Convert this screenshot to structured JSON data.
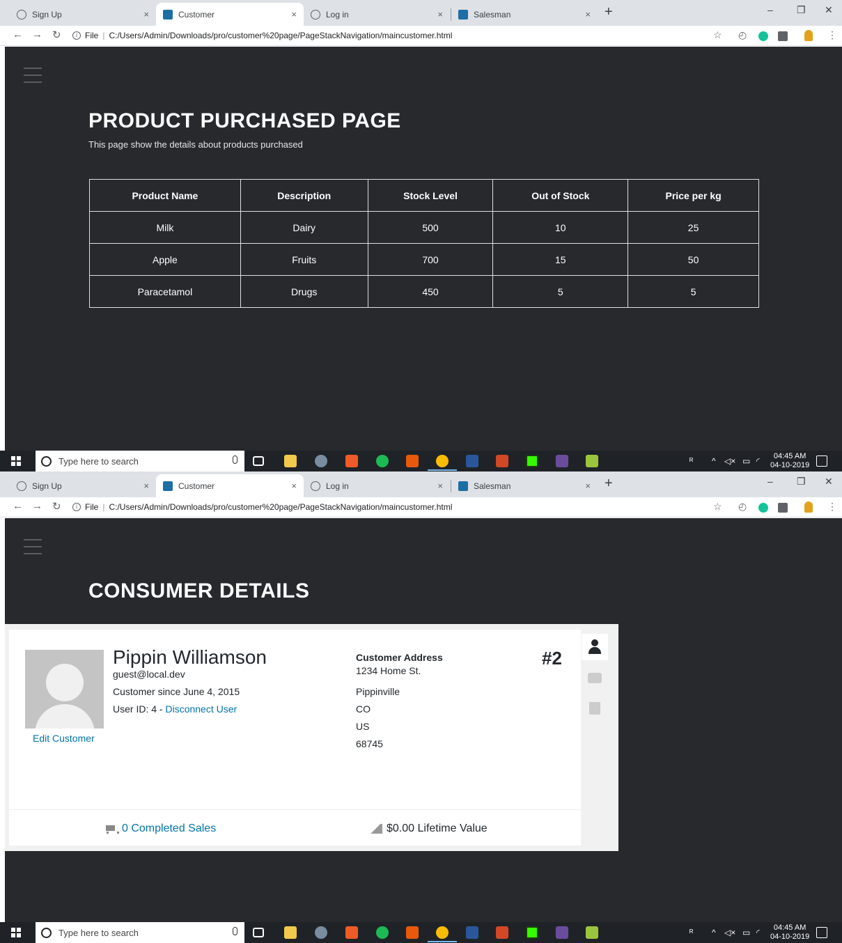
{
  "browser": {
    "tabs": [
      {
        "title": "Sign Up",
        "active": false
      },
      {
        "title": "Customer",
        "active": true
      },
      {
        "title": "Log in",
        "active": false
      },
      {
        "title": "Salesman",
        "active": false
      }
    ],
    "address_prefix": "File",
    "url": "C:/Users/Admin/Downloads/pro/customer%20page/PageStackNavigation/maincustomer.html",
    "new_tab_label": "+",
    "close_label": "×"
  },
  "products_page": {
    "title": "PRODUCT PURCHASED PAGE",
    "subtitle": "This page show the details about products purchased",
    "columns": [
      "Product Name",
      "Description",
      "Stock Level",
      "Out of Stock",
      "Price per kg"
    ],
    "rows": [
      [
        "Milk",
        "Dairy",
        "500",
        "10",
        "25"
      ],
      [
        "Apple",
        "Fruits",
        "700",
        "15",
        "50"
      ],
      [
        "Paracetamol",
        "Drugs",
        "450",
        "5",
        "5"
      ]
    ]
  },
  "consumer_page": {
    "title": "CONSUMER DETAILS",
    "customer": {
      "name": "Pippin Williamson",
      "email": "guest@local.dev",
      "since": "Customer since June 4, 2015",
      "user_id_label": "User ID:  4 - ",
      "disconnect_label": "Disconnect User",
      "edit_label": "Edit Customer",
      "number": "#2",
      "address_heading": "Customer Address",
      "address_lines": [
        "1234 Home St.",
        "Pippinville",
        "CO",
        "US",
        "68745"
      ],
      "sales_label": "0 Completed Sales",
      "lifetime_label": "$0.00 Lifetime Value"
    }
  },
  "taskbar": {
    "search_placeholder": "Type here to search",
    "time": "04:45 AM",
    "date": "04-10-2019"
  },
  "colors": {
    "page_bg": "#27292d",
    "link": "#0073aa",
    "tab_strip": "#dee1e6",
    "taskbar": "#1f2328"
  }
}
